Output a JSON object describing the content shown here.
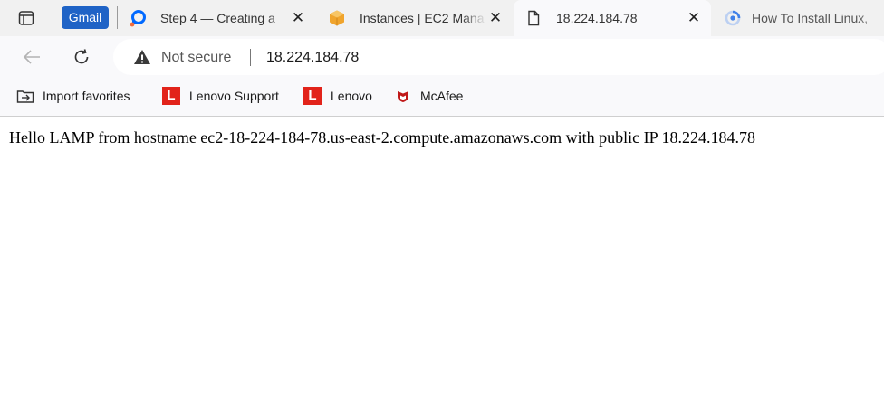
{
  "browser": {
    "tabs": [
      {
        "label": "Step 4 — Creating a",
        "icon": "digitalocean-icon"
      },
      {
        "label": "Instances | EC2 Mana",
        "icon": "aws-icon"
      },
      {
        "label": "18.224.184.78",
        "icon": "page-icon",
        "active": true
      },
      {
        "label": "How To Install Linux,",
        "icon": "digitalocean-loading-icon"
      }
    ],
    "pinned_badge": "Gmail",
    "close_glyph": "✕",
    "security_label": "Not secure",
    "url": "18.224.184.78"
  },
  "favorites": [
    {
      "label": "Import favorites",
      "icon": "import-favorites-icon"
    },
    {
      "label": "Lenovo Support",
      "icon": "lenovo-icon"
    },
    {
      "label": "Lenovo",
      "icon": "lenovo-icon"
    },
    {
      "label": "McAfee",
      "icon": "mcafee-icon"
    }
  ],
  "lenovo_glyph": "L",
  "page": {
    "body_text": "Hello LAMP from hostname ec2-18-224-184-78.us-east-2.compute.amazonaws.com with public IP 18.224.184.78"
  },
  "colors": {
    "gmail_badge": "#1f63c6",
    "lenovo_red": "#e2231a",
    "mcafee_red": "#c01818",
    "aws_orange": "#f0a42c",
    "digitalocean_blue": "#0069ff"
  }
}
